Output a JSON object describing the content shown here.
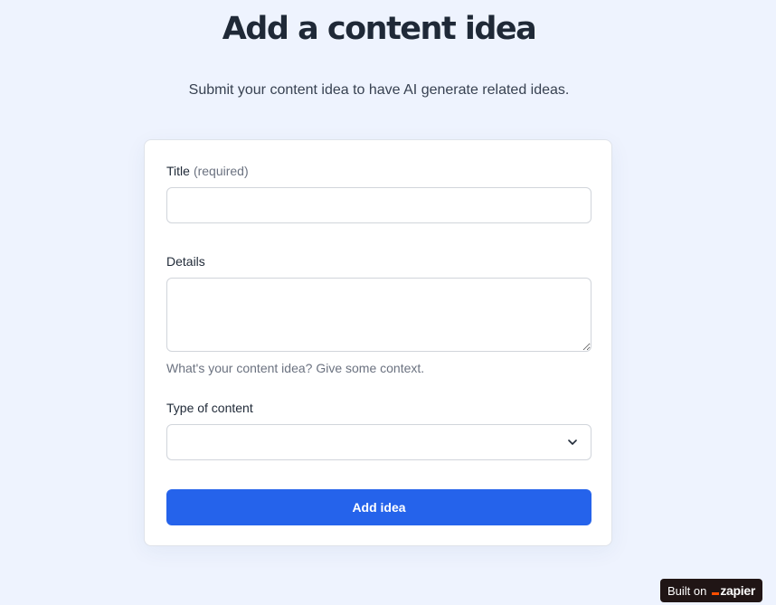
{
  "header": {
    "title": "Add a content idea",
    "subtitle": "Submit your content idea to have AI generate related ideas."
  },
  "form": {
    "title_field": {
      "label": "Title",
      "required_hint": "(required)",
      "value": "",
      "placeholder": ""
    },
    "details_field": {
      "label": "Details",
      "value": "",
      "placeholder": "",
      "help_text": "What's your content idea? Give some context."
    },
    "type_field": {
      "label": "Type of content",
      "selected_value": "",
      "icon": "chevron-down-icon"
    },
    "submit_label": "Add idea"
  },
  "badge": {
    "built_on": "Built on",
    "brand": "zapier",
    "brand_color": "#ff4f00"
  },
  "colors": {
    "background": "#eef3fe",
    "accent": "#2563eb"
  }
}
